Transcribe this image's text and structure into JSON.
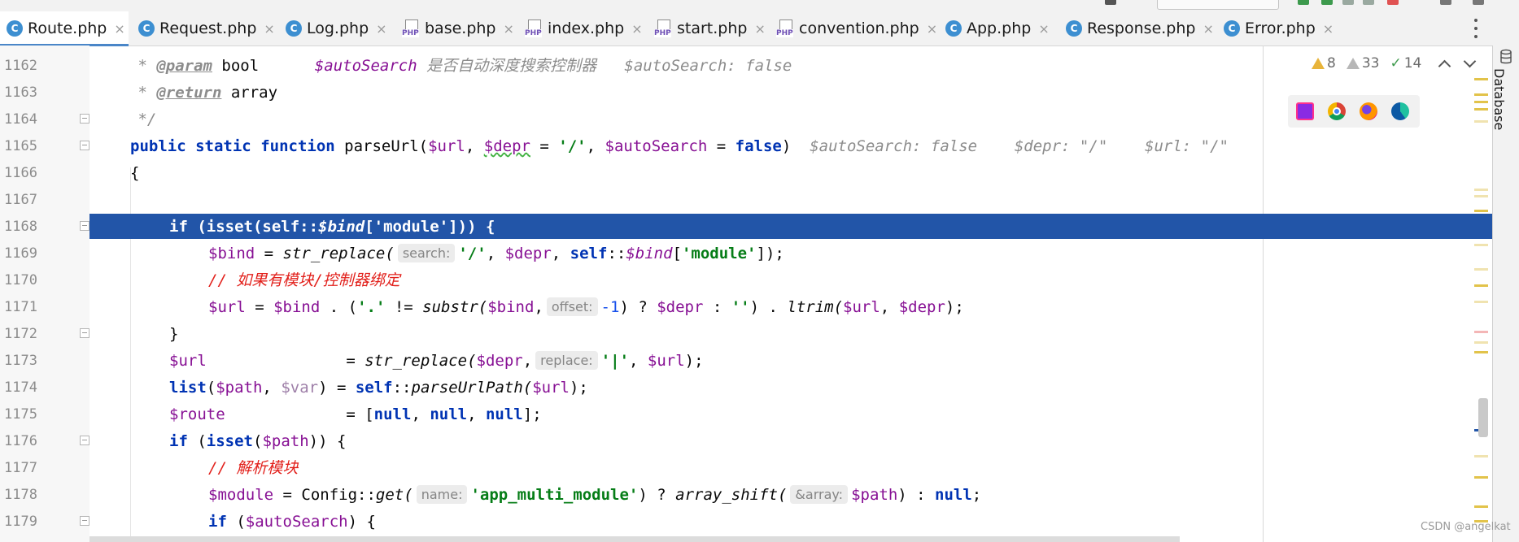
{
  "tabs": [
    {
      "name": "Route.php",
      "icon": "class-icon",
      "active": true
    },
    {
      "name": "Request.php",
      "icon": "class-icon"
    },
    {
      "name": "Log.php",
      "icon": "class-icon"
    },
    {
      "name": "base.php",
      "icon": "php-file-icon"
    },
    {
      "name": "index.php",
      "icon": "php-file-icon"
    },
    {
      "name": "start.php",
      "icon": "php-file-icon"
    },
    {
      "name": "convention.php",
      "icon": "php-file-icon"
    },
    {
      "name": "App.php",
      "icon": "class-icon"
    },
    {
      "name": "Response.php",
      "icon": "class-icon"
    },
    {
      "name": "Error.php",
      "icon": "class-icon"
    }
  ],
  "tab_close_glyph": "×",
  "right_panel": {
    "label": "Database",
    "icon": "database-icon"
  },
  "inspections": {
    "warnings": "8",
    "weak_warnings": "33",
    "typos": "14"
  },
  "browsers": [
    "phpstorm-icon",
    "chrome-icon",
    "firefox-icon",
    "edge-icon"
  ],
  "gutter": {
    "line_numbers": [
      "1162",
      "1163",
      "1164",
      "1165",
      "1166",
      "1167",
      "1168",
      "1169",
      "1170",
      "1171",
      "1172",
      "1173",
      "1174",
      "1175",
      "1176",
      "1177",
      "1178",
      "1179"
    ]
  },
  "code": {
    "l1162": {
      "star": " * ",
      "tag": "@param",
      "type": " bool",
      "gap": "      ",
      "var": "$autoSearch",
      "desc": " 是否自动深度搜索控制器",
      "hint": "   $autoSearch: false"
    },
    "l1163": {
      "star": " * ",
      "tag": "@return",
      "type": " array"
    },
    "l1164": {
      "text": " */"
    },
    "l1165": {
      "kw1": "public",
      "kw2": "static",
      "kw3": "function",
      "name": " parseUrl(",
      "v1": "$url",
      "c1": ", ",
      "v2": "$depr",
      "eq": " = ",
      "s1": "'/'",
      "c2": ", ",
      "v3": "$autoSearch",
      "eq2": " = ",
      "kw4": "false",
      "close": ")",
      "hint": "  $autoSearch: false    $depr: \"/\"    $url: \"/\""
    },
    "l1166": {
      "text": "{"
    },
    "l1168": {
      "a": "if (isset(self::",
      "b": "$bind",
      "c": "['module'])) {"
    },
    "l1169": {
      "v1": "$bind",
      "eq": " = ",
      "fn": "str_replace(",
      "inlay": "search:",
      "s1": "'/'",
      "c1": ", ",
      "v2": "$depr",
      "c2": ", ",
      "kw": "self",
      "dc": "::",
      "sv": "$bind",
      "ob": "[",
      "s2": "'module'",
      "cb": "]);"
    },
    "l1170": {
      "text": "// 如果有模块/控制器绑定"
    },
    "l1171": {
      "v1": "$url",
      "eq": " = ",
      "v2": "$bind",
      "p1": " . (",
      "s1": "'.'",
      "ne": " != ",
      "fn": "substr(",
      "v3": "$bind",
      "c1": ",",
      "inlay": "offset:",
      "num": "-1",
      "tern": ") ? ",
      "v4": "$depr",
      "col": " : ",
      "s2": "''",
      "p2": ") . ",
      "fn2": "ltrim(",
      "v5": "$url",
      "c2": ", ",
      "v6": "$depr",
      "end": ");"
    },
    "l1172": {
      "text": "}"
    },
    "l1173": {
      "v1": "$url",
      "gap": "               = ",
      "fn": "str_replace(",
      "v2": "$depr",
      "c1": ",",
      "inlay": "replace:",
      "s1": "'|'",
      "c2": ", ",
      "v3": "$url",
      "end": ");"
    },
    "l1174": {
      "kw": "list",
      "op": "(",
      "v1": "$path",
      "c1": ", ",
      "v2": "$var",
      "p1": ") = ",
      "kw2": "self",
      "dc": "::",
      "fn": "parseUrlPath(",
      "v3": "$url",
      "end": ");"
    },
    "l1175": {
      "v1": "$route",
      "gap": "             = [",
      "n1": "null",
      "c1": ", ",
      "n2": "null",
      "c2": ", ",
      "n3": "null",
      "end": "];"
    },
    "l1176": {
      "kw": "if",
      "p1": " (",
      "kw2": "isset",
      "p2": "(",
      "v1": "$path",
      "end": ")) {"
    },
    "l1177": {
      "text": "// 解析模块"
    },
    "l1178": {
      "v1": "$module",
      "eq": " = Config::",
      "fn": "get(",
      "inlay": "name:",
      "s1": "'app_multi_module'",
      "p1": ") ? ",
      "fn2": "array_shift(",
      "inlay2": "&array:",
      "v2": "$path",
      "p2": ") : ",
      "kw": "null",
      "end": ";"
    },
    "l1179": {
      "kw": "if",
      "p1": " (",
      "v1": "$autoSearch",
      "end": ") {"
    }
  },
  "colors": {
    "selection": "#2255a8",
    "keyword": "#0033b3",
    "variable": "#871094",
    "string": "#067d17",
    "comment_cn": "#e2211c",
    "accent_tab": "#4a86c8",
    "warning": "#e8b43a"
  },
  "watermark": "CSDN @angelkat"
}
